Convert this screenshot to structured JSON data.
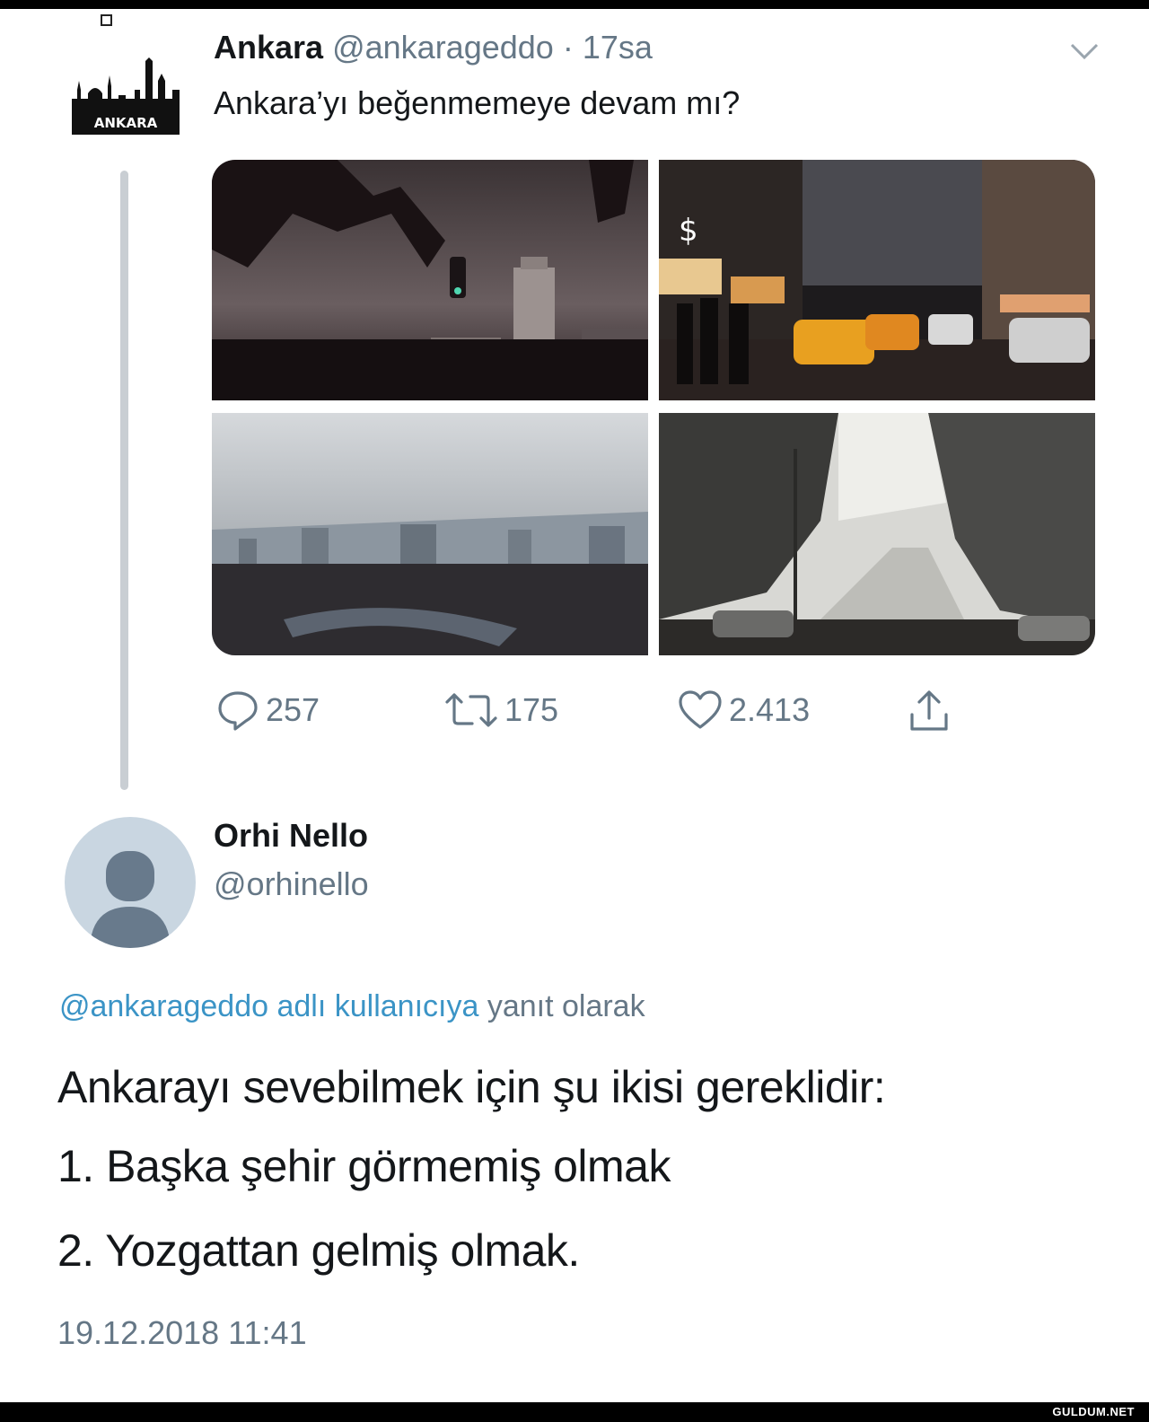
{
  "tweet1": {
    "avatar_text": "ANKARA",
    "name": "Ankara",
    "handle": "@ankarageddo",
    "time": "· 17sa",
    "text": "Ankara’yı beğenmemeye devam mı?",
    "photos": [
      "dark-sky-tower-photo",
      "night-street-taxis-photo",
      "city-panorama-photo",
      "snowy-trees-street-photo"
    ],
    "stats": {
      "replies": "257",
      "retweets": "175",
      "likes": "2.413"
    }
  },
  "tweet2": {
    "name": "Orhi Nello",
    "handle": "@orhinello",
    "reply_mention": "@ankarageddo adlı kullanıcıya",
    "reply_suffix": "yanıt olarak",
    "lines": [
      "Ankarayı sevebilmek için şu ikisi gereklidir:",
      "1. Başka şehir görmemiş olmak",
      "2. Yozgattan gelmiş olmak."
    ],
    "timestamp": "19.12.2018 11:41"
  },
  "watermark": "GULDUM.NET",
  "colors": {
    "text": "#14171a",
    "muted": "#657786",
    "link": "#3b94c6",
    "thread": "#c9ced3"
  },
  "icons": [
    "reply-icon",
    "retweet-icon",
    "like-icon",
    "share-icon",
    "chevron-down-icon"
  ]
}
